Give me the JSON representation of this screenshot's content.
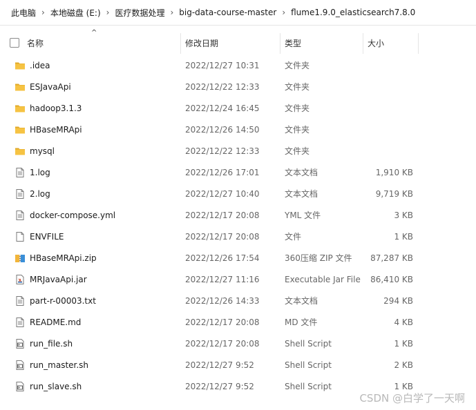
{
  "breadcrumb": [
    "此电脑",
    "本地磁盘 (E:)",
    "医疗数据处理",
    "big-data-course-master",
    "flume1.9.0_elasticsearch7.8.0"
  ],
  "breadcrumb_separator": "›",
  "header": {
    "sort_arrow": "^",
    "name": "名称",
    "date": "修改日期",
    "type": "类型",
    "size": "大小"
  },
  "files": [
    {
      "name": ".idea",
      "date": "2022/12/27 10:31",
      "type": "文件夹",
      "size": "",
      "icon": "folder-icon"
    },
    {
      "name": "ESJavaApi",
      "date": "2022/12/22 12:33",
      "type": "文件夹",
      "size": "",
      "icon": "folder-icon"
    },
    {
      "name": "hadoop3.1.3",
      "date": "2022/12/24 16:45",
      "type": "文件夹",
      "size": "",
      "icon": "folder-icon"
    },
    {
      "name": "HBaseMRApi",
      "date": "2022/12/26 14:50",
      "type": "文件夹",
      "size": "",
      "icon": "folder-icon"
    },
    {
      "name": "mysql",
      "date": "2022/12/22 12:33",
      "type": "文件夹",
      "size": "",
      "icon": "folder-icon"
    },
    {
      "name": "1.log",
      "date": "2022/12/26 17:01",
      "type": "文本文档",
      "size": "1,910 KB",
      "icon": "text-file-icon"
    },
    {
      "name": "2.log",
      "date": "2022/12/27 10:40",
      "type": "文本文档",
      "size": "9,719 KB",
      "icon": "text-file-icon"
    },
    {
      "name": "docker-compose.yml",
      "date": "2022/12/17 20:08",
      "type": "YML 文件",
      "size": "3 KB",
      "icon": "text-file-icon"
    },
    {
      "name": "ENVFILE",
      "date": "2022/12/17 20:08",
      "type": "文件",
      "size": "1 KB",
      "icon": "blank-file-icon"
    },
    {
      "name": "HBaseMRApi.zip",
      "date": "2022/12/26 17:54",
      "type": "360压缩 ZIP 文件",
      "size": "87,287 KB",
      "icon": "zip-file-icon"
    },
    {
      "name": "MRJavaApi.jar",
      "date": "2022/12/27 11:16",
      "type": "Executable Jar File",
      "size": "86,410 KB",
      "icon": "jar-file-icon"
    },
    {
      "name": "part-r-00003.txt",
      "date": "2022/12/26 14:33",
      "type": "文本文档",
      "size": "294 KB",
      "icon": "text-file-icon"
    },
    {
      "name": "README.md",
      "date": "2022/12/17 20:08",
      "type": "MD 文件",
      "size": "4 KB",
      "icon": "text-file-icon"
    },
    {
      "name": "run_file.sh",
      "date": "2022/12/17 20:08",
      "type": "Shell Script",
      "size": "1 KB",
      "icon": "shell-script-icon"
    },
    {
      "name": "run_master.sh",
      "date": "2022/12/27 9:52",
      "type": "Shell Script",
      "size": "2 KB",
      "icon": "shell-script-icon"
    },
    {
      "name": "run_slave.sh",
      "date": "2022/12/27 9:52",
      "type": "Shell Script",
      "size": "1 KB",
      "icon": "shell-script-icon"
    }
  ],
  "watermark": "CSDN @白学了一天啊",
  "colors": {
    "folder": "#f6c343",
    "folder_dark": "#e0a92a",
    "file_border": "#7a7a7a",
    "text_muted": "#666666"
  }
}
